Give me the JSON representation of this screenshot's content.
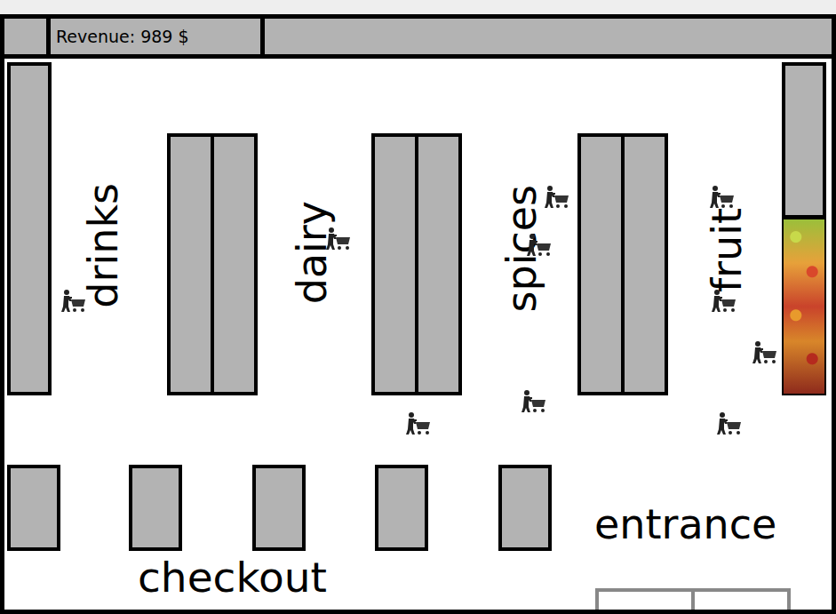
{
  "top_bar": {
    "revenue": "Revenue: 989 $"
  },
  "aisles": [
    {
      "label": "drinks"
    },
    {
      "label": "dairy"
    },
    {
      "label": "spices"
    },
    {
      "label": "fruit"
    }
  ],
  "checkout": {
    "label": "checkout",
    "counters": 5
  },
  "entrance": {
    "label": "entrance"
  },
  "shoppers": 10
}
